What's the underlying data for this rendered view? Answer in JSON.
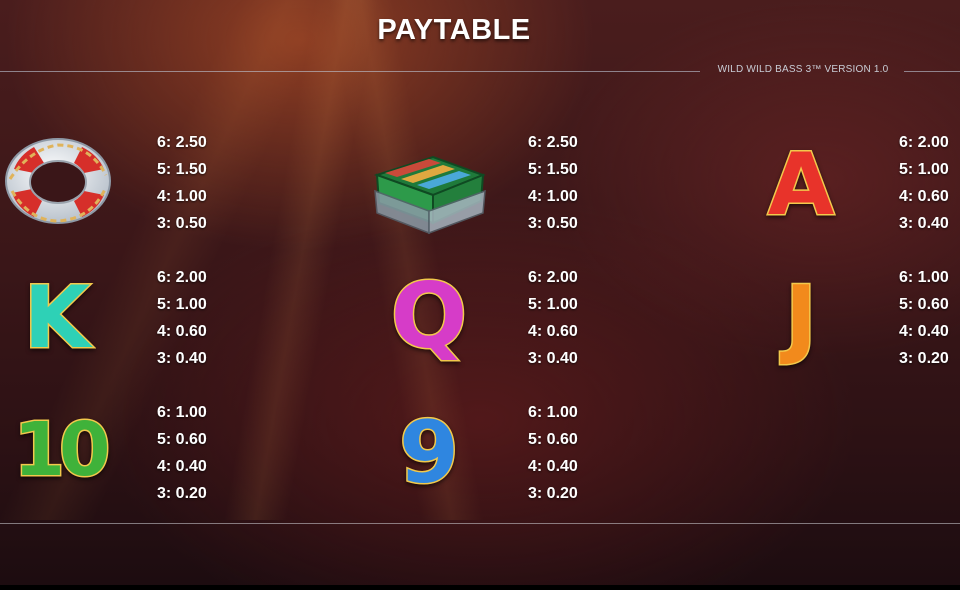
{
  "title": "PAYTABLE",
  "version": "WILD WILD BASS 3™ VERSION 1.0",
  "symbols": [
    {
      "name": "lifebuoy",
      "icon": "lifebuoy-icon",
      "pays": [
        "6: 2.50",
        "5: 1.50",
        "4: 1.00",
        "3: 0.50"
      ]
    },
    {
      "name": "tackle-box",
      "icon": "tackle-box-icon",
      "pays": [
        "6: 2.50",
        "5: 1.50",
        "4: 1.00",
        "3: 0.50"
      ]
    },
    {
      "name": "A",
      "letter": "A",
      "color": "#e8332a",
      "pays": [
        "6: 2.00",
        "5: 1.00",
        "4: 0.60",
        "3: 0.40"
      ]
    },
    {
      "name": "K",
      "letter": "K",
      "color": "#2ed1b6",
      "pays": [
        "6: 2.00",
        "5: 1.00",
        "4: 0.60",
        "3: 0.40"
      ]
    },
    {
      "name": "Q",
      "letter": "Q",
      "color": "#d63cc8",
      "pays": [
        "6: 2.00",
        "5: 1.00",
        "4: 0.60",
        "3: 0.40"
      ]
    },
    {
      "name": "J",
      "letter": "J",
      "color": "#f28a1c",
      "pays": [
        "6: 1.00",
        "5: 0.60",
        "4: 0.40",
        "3: 0.20"
      ]
    },
    {
      "name": "10",
      "letter": "10",
      "color": "#3fb23a",
      "pays": [
        "6: 1.00",
        "5: 0.60",
        "4: 0.40",
        "3: 0.20"
      ]
    },
    {
      "name": "9",
      "letter": "9",
      "color": "#2f86e0",
      "pays": [
        "6: 1.00",
        "5: 0.60",
        "4: 0.40",
        "3: 0.20"
      ]
    }
  ]
}
